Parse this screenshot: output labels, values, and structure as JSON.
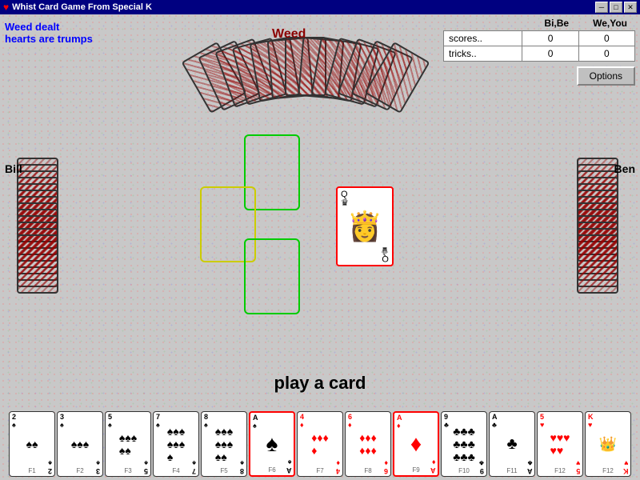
{
  "titlebar": {
    "icon": "♥",
    "title": "Whist Card Game From Special K",
    "btn_minimize": "─",
    "btn_restore": "□",
    "btn_close": "✕"
  },
  "left_info": {
    "dealt": "Weed dealt",
    "trumps": "hearts are trumps"
  },
  "score_header": {
    "col1": "Bi,Be",
    "col2": "We,You"
  },
  "scores": {
    "scores_label": "scores..",
    "scores_bi": "0",
    "scores_we": "0",
    "tricks_label": "tricks..",
    "tricks_bi": "0",
    "tricks_we": "0"
  },
  "options_btn": "Options",
  "players": {
    "top": "Weed",
    "left": "Bill",
    "right": "Ben"
  },
  "play_prompt": "play a card",
  "center_card": {
    "rank": "Q",
    "suit": "♛",
    "color": "red"
  },
  "hand": [
    {
      "rank": "2",
      "suit": "♠",
      "color": "black",
      "fkey": "F1"
    },
    {
      "rank": "3",
      "suit": "♠",
      "color": "black",
      "fkey": "F2"
    },
    {
      "rank": "5",
      "suit": "♠",
      "color": "black",
      "fkey": "F3"
    },
    {
      "rank": "7",
      "suit": "♠",
      "color": "black",
      "fkey": "F4"
    },
    {
      "rank": "8",
      "suit": "♠",
      "color": "black",
      "fkey": "F5"
    },
    {
      "rank": "A",
      "suit": "♠",
      "color": "black",
      "fkey": "F6",
      "big": true
    },
    {
      "rank": "4",
      "suit": "♦",
      "color": "red",
      "fkey": "F7"
    },
    {
      "rank": "6",
      "suit": "♦",
      "color": "red",
      "fkey": "F8"
    },
    {
      "rank": "A",
      "suit": "♦",
      "color": "red",
      "fkey": "F9",
      "big": true
    },
    {
      "rank": "9",
      "suit": "♣",
      "color": "black",
      "fkey": "F10"
    },
    {
      "rank": "A",
      "suit": "♣",
      "color": "black",
      "fkey": "F11"
    },
    {
      "rank": "5",
      "suit": "♥",
      "color": "red",
      "fkey": "F12"
    },
    {
      "rank": "K",
      "suit": "",
      "color": "red",
      "fkey": "F12",
      "king": true
    }
  ]
}
